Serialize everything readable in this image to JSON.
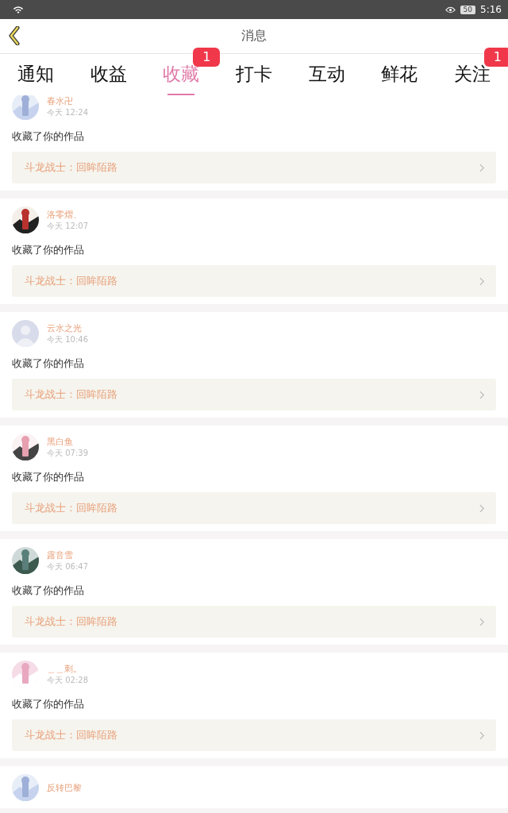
{
  "status_bar": {
    "time": "5:16",
    "battery": "50"
  },
  "header": {
    "title": "消息"
  },
  "tabs": [
    {
      "label": "通知",
      "selected": false
    },
    {
      "label": "收益",
      "selected": false
    },
    {
      "label": "收藏",
      "selected": true,
      "badge": "1"
    },
    {
      "label": "打卡",
      "selected": false
    },
    {
      "label": "互动",
      "selected": false
    },
    {
      "label": "鲜花",
      "selected": false
    },
    {
      "label": "关注",
      "selected": false,
      "badge": "1"
    }
  ],
  "messages": [
    {
      "user": "春水卍",
      "time": "今天 12:24",
      "default_avatar": false,
      "text": "收藏了你的作品",
      "work": "斗龙战士：回眸陌路"
    },
    {
      "user": "洛零熠、",
      "time": "今天 12:07",
      "default_avatar": false,
      "text": "收藏了你的作品",
      "work": "斗龙战士：回眸陌路"
    },
    {
      "user": "云水之光",
      "time": "今天 10:46",
      "default_avatar": true,
      "text": "收藏了你的作品",
      "work": "斗龙战士：回眸陌路"
    },
    {
      "user": "黑白鱼",
      "time": "今天 07:39",
      "default_avatar": false,
      "text": "收藏了你的作品",
      "work": "斗龙战士：回眸陌路"
    },
    {
      "user": "露音雪",
      "time": "今天 06:47",
      "default_avatar": false,
      "text": "收藏了你的作品",
      "work": "斗龙战士：回眸陌路"
    },
    {
      "user": "＿＿刺。",
      "time": "今天 02:28",
      "default_avatar": false,
      "text": "收藏了你的作品",
      "work": "斗龙战士：回眸陌路"
    },
    {
      "user": "反转巴黎",
      "default_avatar": false
    }
  ]
}
